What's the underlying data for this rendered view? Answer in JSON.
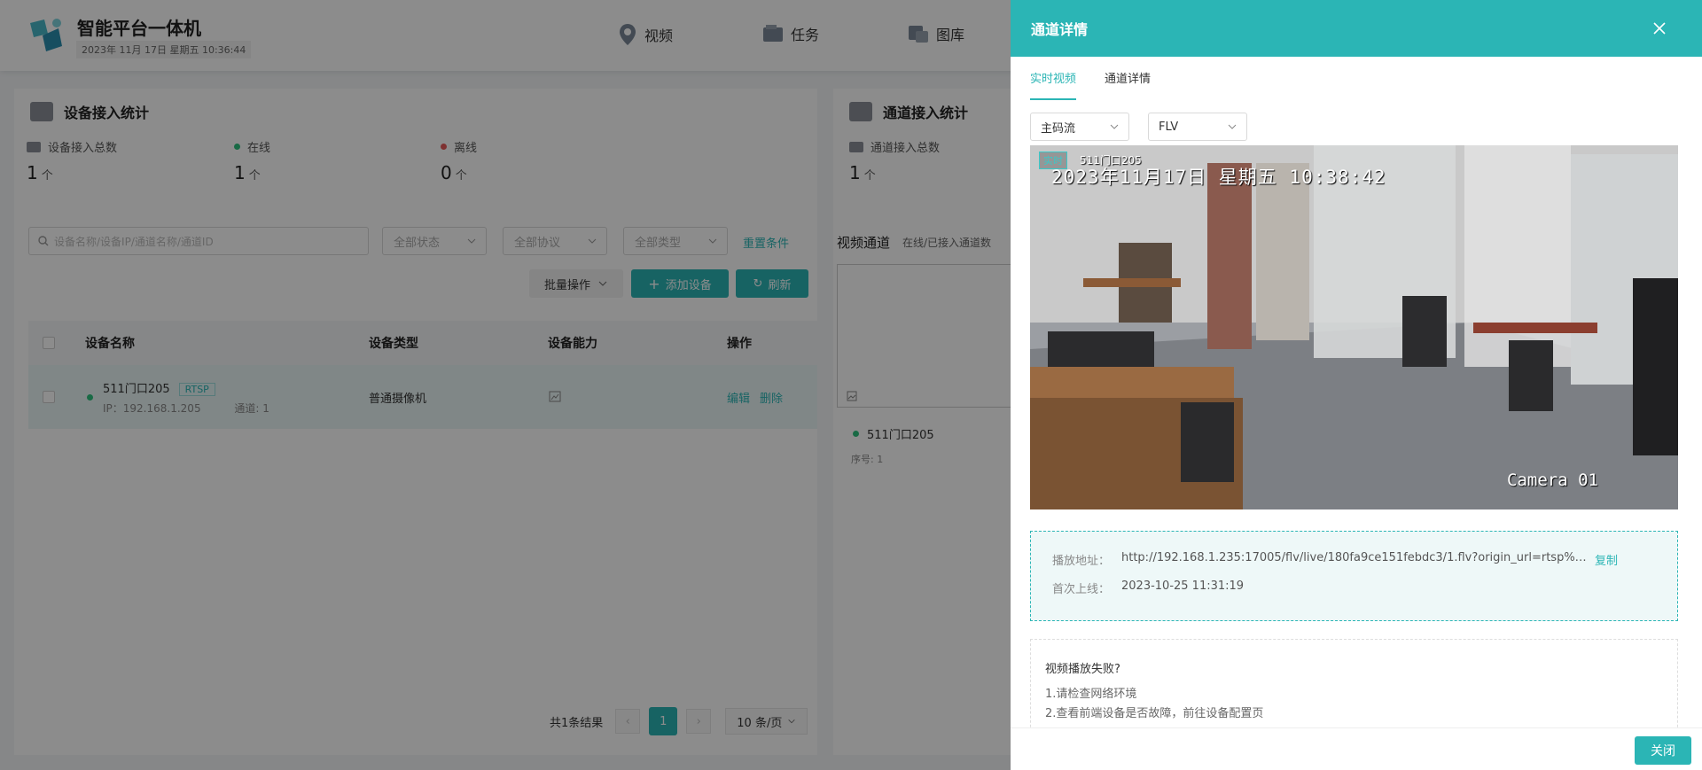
{
  "app": {
    "title": "智能平台一体机",
    "datetime": "2023年 11月 17日 星期五 10:36:44",
    "nav": [
      "视频",
      "任务",
      "图库"
    ]
  },
  "device_stats": {
    "title": "设备接入统计",
    "total_label": "设备接入总数",
    "total_value": "1",
    "online_label": "在线",
    "online_value": "1",
    "offline_label": "离线",
    "offline_value": "0",
    "unit": "个"
  },
  "channel_stats": {
    "title": "通道接入统计",
    "total_label": "通道接入总数",
    "total_value": "1",
    "unit": "个"
  },
  "filters": {
    "search_placeholder": "设备名称/设备IP/通道名称/通道ID",
    "status": "全部状态",
    "protocol": "全部协议",
    "type": "全部类型",
    "reset": "重置条件"
  },
  "actions": {
    "batch": "批量操作",
    "add": "添加设备",
    "refresh": "刷新"
  },
  "table": {
    "headers": [
      "设备名称",
      "设备类型",
      "设备能力",
      "操作"
    ],
    "row": {
      "name": "511门口205",
      "protocol": "RTSP",
      "ip_label": "IP：",
      "ip": "192.168.1.205",
      "channel": "通道: 1",
      "type": "普通摄像机",
      "edit": "编辑",
      "delete": "删除"
    }
  },
  "pagination": {
    "total": "共1条结果",
    "current": "1",
    "page_size": "10 条/页"
  },
  "channels": {
    "title": "视频通道",
    "subtitle": "在线/已接入通道数",
    "card_name": "511门口205",
    "card_seq": "序号: 1"
  },
  "drawer": {
    "title": "通道详情",
    "tabs": [
      "实时视频",
      "通道详情"
    ],
    "stream_select": "主码流",
    "format_select": "FLV",
    "video": {
      "live_badge": "实时",
      "camera_name": "511门口205",
      "timestamp": "2023年11月17日  星期五  10:38:42",
      "camera_label": "Camera 01"
    },
    "play_url_label": "播放地址：",
    "play_url": "http://192.168.1.235:17005/flv/live/180fa9ce151febdc3/1.flv?origin_url=rtsp%3…",
    "copy": "复制",
    "first_online_label": "首次上线：",
    "first_online": "2023-10-25 11:31:19",
    "help_title": "视频播放失败?",
    "help_lines": [
      "1.请检查网络环境",
      "2.查看前端设备是否故障，前往设备配置页"
    ],
    "close_button": "关闭"
  },
  "colors": {
    "accent": "#2bb5b5",
    "online": "#2ec27e",
    "offline": "#e65a5a"
  }
}
